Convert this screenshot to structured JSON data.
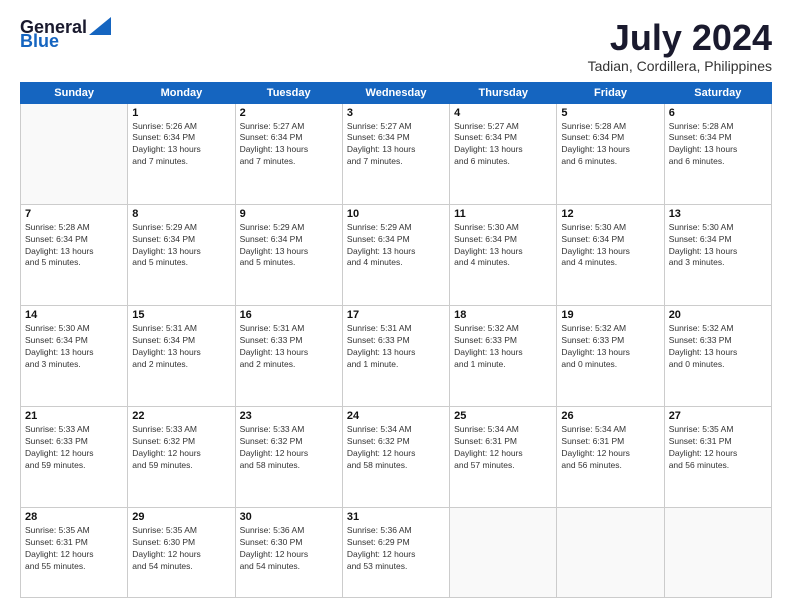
{
  "header": {
    "logo_line1": "General",
    "logo_line2": "Blue",
    "month_year": "July 2024",
    "location": "Tadian, Cordillera, Philippines"
  },
  "days_of_week": [
    "Sunday",
    "Monday",
    "Tuesday",
    "Wednesday",
    "Thursday",
    "Friday",
    "Saturday"
  ],
  "weeks": [
    [
      {
        "day": "",
        "info": ""
      },
      {
        "day": "1",
        "info": "Sunrise: 5:26 AM\nSunset: 6:34 PM\nDaylight: 13 hours\nand 7 minutes."
      },
      {
        "day": "2",
        "info": "Sunrise: 5:27 AM\nSunset: 6:34 PM\nDaylight: 13 hours\nand 7 minutes."
      },
      {
        "day": "3",
        "info": "Sunrise: 5:27 AM\nSunset: 6:34 PM\nDaylight: 13 hours\nand 7 minutes."
      },
      {
        "day": "4",
        "info": "Sunrise: 5:27 AM\nSunset: 6:34 PM\nDaylight: 13 hours\nand 6 minutes."
      },
      {
        "day": "5",
        "info": "Sunrise: 5:28 AM\nSunset: 6:34 PM\nDaylight: 13 hours\nand 6 minutes."
      },
      {
        "day": "6",
        "info": "Sunrise: 5:28 AM\nSunset: 6:34 PM\nDaylight: 13 hours\nand 6 minutes."
      }
    ],
    [
      {
        "day": "7",
        "info": "Sunrise: 5:28 AM\nSunset: 6:34 PM\nDaylight: 13 hours\nand 5 minutes."
      },
      {
        "day": "8",
        "info": "Sunrise: 5:29 AM\nSunset: 6:34 PM\nDaylight: 13 hours\nand 5 minutes."
      },
      {
        "day": "9",
        "info": "Sunrise: 5:29 AM\nSunset: 6:34 PM\nDaylight: 13 hours\nand 5 minutes."
      },
      {
        "day": "10",
        "info": "Sunrise: 5:29 AM\nSunset: 6:34 PM\nDaylight: 13 hours\nand 4 minutes."
      },
      {
        "day": "11",
        "info": "Sunrise: 5:30 AM\nSunset: 6:34 PM\nDaylight: 13 hours\nand 4 minutes."
      },
      {
        "day": "12",
        "info": "Sunrise: 5:30 AM\nSunset: 6:34 PM\nDaylight: 13 hours\nand 4 minutes."
      },
      {
        "day": "13",
        "info": "Sunrise: 5:30 AM\nSunset: 6:34 PM\nDaylight: 13 hours\nand 3 minutes."
      }
    ],
    [
      {
        "day": "14",
        "info": "Sunrise: 5:30 AM\nSunset: 6:34 PM\nDaylight: 13 hours\nand 3 minutes."
      },
      {
        "day": "15",
        "info": "Sunrise: 5:31 AM\nSunset: 6:34 PM\nDaylight: 13 hours\nand 2 minutes."
      },
      {
        "day": "16",
        "info": "Sunrise: 5:31 AM\nSunset: 6:33 PM\nDaylight: 13 hours\nand 2 minutes."
      },
      {
        "day": "17",
        "info": "Sunrise: 5:31 AM\nSunset: 6:33 PM\nDaylight: 13 hours\nand 1 minute."
      },
      {
        "day": "18",
        "info": "Sunrise: 5:32 AM\nSunset: 6:33 PM\nDaylight: 13 hours\nand 1 minute."
      },
      {
        "day": "19",
        "info": "Sunrise: 5:32 AM\nSunset: 6:33 PM\nDaylight: 13 hours\nand 0 minutes."
      },
      {
        "day": "20",
        "info": "Sunrise: 5:32 AM\nSunset: 6:33 PM\nDaylight: 13 hours\nand 0 minutes."
      }
    ],
    [
      {
        "day": "21",
        "info": "Sunrise: 5:33 AM\nSunset: 6:33 PM\nDaylight: 12 hours\nand 59 minutes."
      },
      {
        "day": "22",
        "info": "Sunrise: 5:33 AM\nSunset: 6:32 PM\nDaylight: 12 hours\nand 59 minutes."
      },
      {
        "day": "23",
        "info": "Sunrise: 5:33 AM\nSunset: 6:32 PM\nDaylight: 12 hours\nand 58 minutes."
      },
      {
        "day": "24",
        "info": "Sunrise: 5:34 AM\nSunset: 6:32 PM\nDaylight: 12 hours\nand 58 minutes."
      },
      {
        "day": "25",
        "info": "Sunrise: 5:34 AM\nSunset: 6:31 PM\nDaylight: 12 hours\nand 57 minutes."
      },
      {
        "day": "26",
        "info": "Sunrise: 5:34 AM\nSunset: 6:31 PM\nDaylight: 12 hours\nand 56 minutes."
      },
      {
        "day": "27",
        "info": "Sunrise: 5:35 AM\nSunset: 6:31 PM\nDaylight: 12 hours\nand 56 minutes."
      }
    ],
    [
      {
        "day": "28",
        "info": "Sunrise: 5:35 AM\nSunset: 6:31 PM\nDaylight: 12 hours\nand 55 minutes."
      },
      {
        "day": "29",
        "info": "Sunrise: 5:35 AM\nSunset: 6:30 PM\nDaylight: 12 hours\nand 54 minutes."
      },
      {
        "day": "30",
        "info": "Sunrise: 5:36 AM\nSunset: 6:30 PM\nDaylight: 12 hours\nand 54 minutes."
      },
      {
        "day": "31",
        "info": "Sunrise: 5:36 AM\nSunset: 6:29 PM\nDaylight: 12 hours\nand 53 minutes."
      },
      {
        "day": "",
        "info": ""
      },
      {
        "day": "",
        "info": ""
      },
      {
        "day": "",
        "info": ""
      }
    ]
  ]
}
